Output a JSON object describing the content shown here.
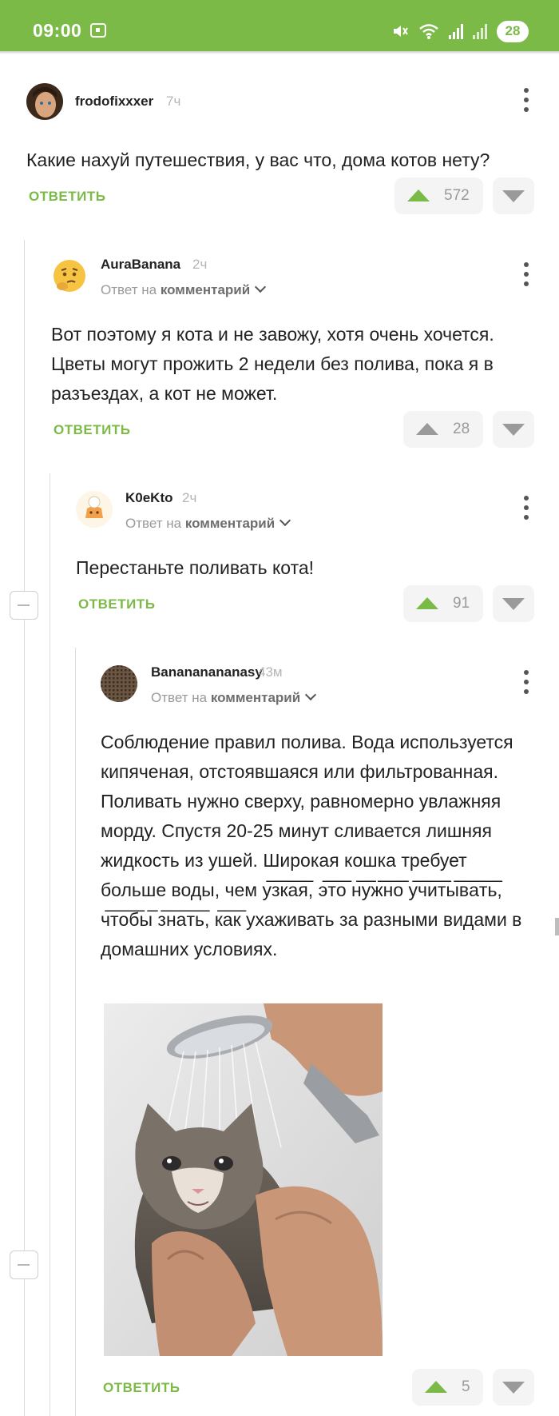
{
  "status_bar": {
    "time": "09:00",
    "battery": "28",
    "accent_color": "#7cba47"
  },
  "labels": {
    "reply": "ОТВЕТИТЬ",
    "reply_to_prefix": "Ответ на",
    "reply_to_link": "комментарий"
  },
  "comments": [
    {
      "username": "frodofixxxer",
      "time": "7ч",
      "text": "Какие нахуй путешествия, у вас что, дома котов нету?",
      "rating": "572"
    },
    {
      "username": "AuraBanana",
      "time": "2ч",
      "text": "Вот поэтому я кота и не завожу, хотя очень хочется. Цветы могут прожить 2 недели без полива, пока я в разъездах, а кот не может.",
      "rating": "28"
    },
    {
      "username": "K0eKto",
      "time": "2ч",
      "text": "Перестаньте поливать кота!",
      "rating": "91"
    },
    {
      "username": "Banananananasy",
      "time": "43м",
      "text": "Соблюдение правил полива. Вода используется кипяченая, отстоявшаяся или фильтрованная. Поливать нужно сверху, равномерно увлажняя морду. Спустя 20-25 минут сливается лишняя жидкость из ушей. Широкая кошка требует больше воды, чем у̅з̅к̅а̅я̅, э̅т̅о̅ н̅у̅ж̅н̅о̅ у̅ч̅и̅т̅ы̅в̅а̅т̅ь̅, ч̅т̅о̅б̅ы̅ з̅н̅а̅т̅ь̅, к̅а̅к̅ ухаживать за разными видами в домашних условиях.",
      "rating": "5",
      "image": "crying-wet-cat-under-shower"
    }
  ]
}
